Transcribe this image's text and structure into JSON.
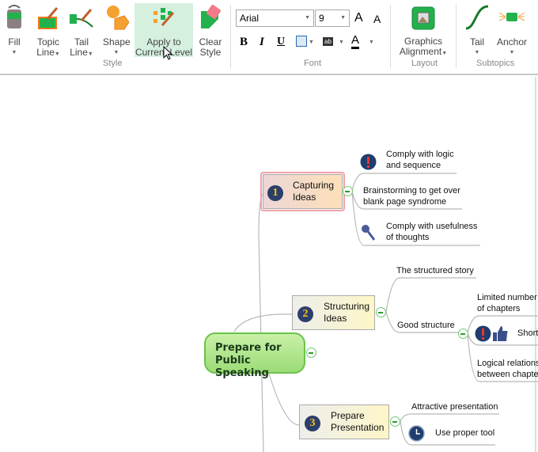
{
  "ribbon": {
    "style": {
      "group": "Style",
      "fill": "Fill",
      "topic_line": [
        "Topic",
        "Line"
      ],
      "tail_line": [
        "Tail",
        "Line"
      ],
      "shape": "Shape",
      "apply": [
        "Apply to",
        "Current Level"
      ],
      "clear": [
        "Clear",
        "Style"
      ]
    },
    "font": {
      "group": "Font",
      "family": "Arial",
      "size": "9",
      "bold": "B",
      "italic": "I",
      "underline": "U",
      "highlight": "ab",
      "color_letter": "A",
      "grow": "A",
      "shrink": "A"
    },
    "layout": {
      "group": "Layout",
      "graphics": [
        "Graphics",
        "Alignment"
      ]
    },
    "subtopics": {
      "group": "Subtopics",
      "tail": "Tail",
      "anchor": "Anchor"
    }
  },
  "map": {
    "central": [
      "Prepare for",
      "Public Speaking"
    ],
    "topics": [
      {
        "num": "1",
        "label": [
          "Capturing",
          "Ideas"
        ],
        "subs": [
          [
            "Comply with logic",
            "and sequence"
          ],
          [
            "Brainstorming to get over",
            "blank page syndrome"
          ],
          [
            "Comply with usefulness",
            " of  thoughts"
          ]
        ]
      },
      {
        "num": "2",
        "label": [
          "Structuring",
          "Ideas"
        ],
        "subs": [
          "The structured story",
          "Good structure"
        ],
        "good_structure": [
          [
            "Limited number",
            "of chapters"
          ],
          "Short",
          [
            "Logical relations",
            "between chapte"
          ]
        ]
      },
      {
        "num": "3",
        "label": [
          "Prepare",
          "Presentation"
        ],
        "subs": [
          "Attractive presentation",
          "Use proper tool"
        ]
      }
    ]
  },
  "colors": {
    "central_fill": "#a8e08a",
    "accent": "#2f9a2f",
    "icon_navy": "#1f3d6e"
  }
}
